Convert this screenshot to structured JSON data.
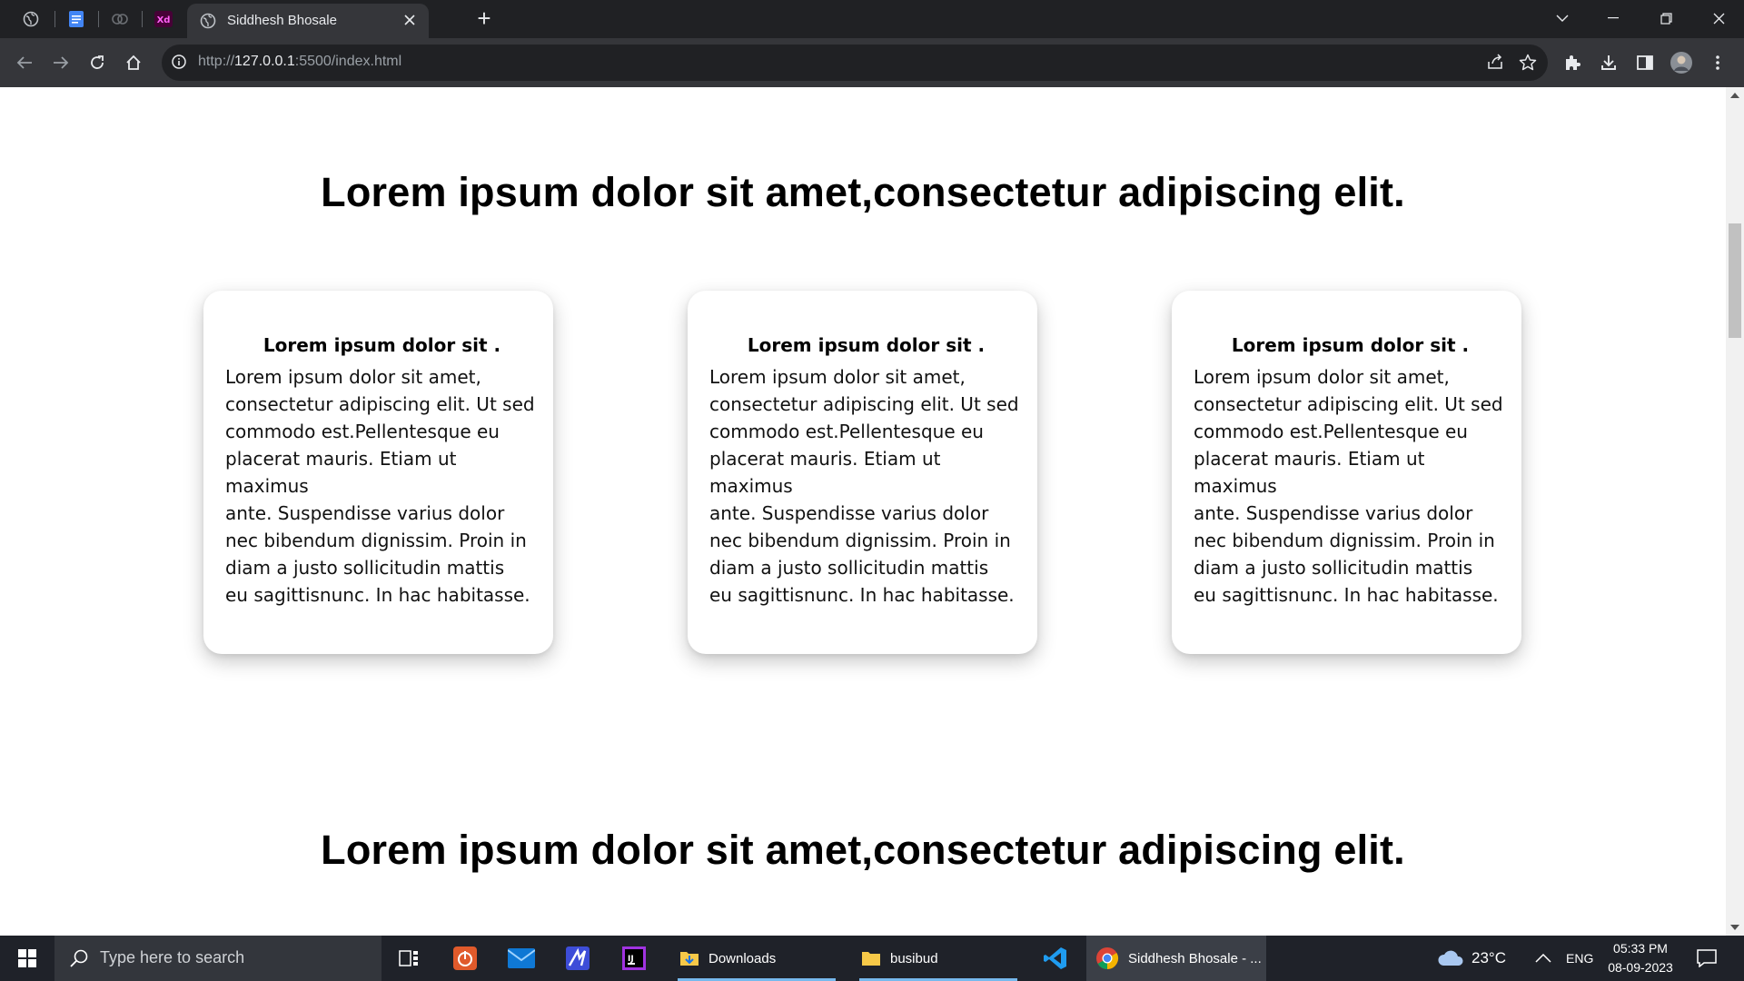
{
  "browser": {
    "active_tab": {
      "title": "Siddhesh Bhosale"
    },
    "new_tab_label": "+",
    "url": {
      "scheme": "http://",
      "host": "127.0.0.1",
      "rest": ":5500/index.html"
    }
  },
  "page": {
    "heading_1": "Lorem ipsum dolor sit amet,consectetur adipiscing elit.",
    "cards": [
      {
        "title": "Lorem ipsum dolor sit .",
        "lines": [
          "Lorem ipsum dolor sit amet,",
          "consectetur adipiscing elit. Ut sed",
          "commodo est.Pellentesque eu",
          "placerat mauris. Etiam ut maximus",
          "ante. Suspendisse varius dolor",
          "nec bibendum dignissim. Proin in",
          "diam a justo sollicitudin mattis",
          "eu sagittisnunc. In hac habitasse."
        ]
      },
      {
        "title": "Lorem ipsum dolor sit .",
        "lines": [
          "Lorem ipsum dolor sit amet,",
          "consectetur adipiscing elit. Ut sed",
          "commodo est.Pellentesque eu",
          "placerat mauris. Etiam ut maximus",
          "ante. Suspendisse varius dolor",
          "nec bibendum dignissim. Proin in",
          "diam a justo sollicitudin mattis",
          "eu sagittisnunc. In hac habitasse."
        ]
      },
      {
        "title": "Lorem ipsum dolor sit .",
        "lines": [
          "Lorem ipsum dolor sit amet,",
          "consectetur adipiscing elit. Ut sed",
          "commodo est.Pellentesque eu",
          "placerat mauris. Etiam ut maximus",
          "ante. Suspendisse varius dolor",
          "nec bibendum dignissim. Proin in",
          "diam a justo sollicitudin mattis",
          "eu sagittisnunc. In hac habitasse."
        ]
      }
    ],
    "heading_2": "Lorem ipsum dolor sit amet,consectetur adipiscing elit."
  },
  "taskbar": {
    "search_placeholder": "Type here to search",
    "apps": {
      "downloads": "Downloads",
      "busibud": "busibud",
      "chrome": "Siddhesh Bhosale - ..."
    },
    "weather": "23°C",
    "language": "ENG",
    "time": "05:33 PM",
    "date": "08-09-2023"
  },
  "colors": {
    "tabstrip": "#202124",
    "toolbar": "#35363a",
    "taskbar": "#1f2229",
    "taskbar_accent": "#76b9ed"
  }
}
